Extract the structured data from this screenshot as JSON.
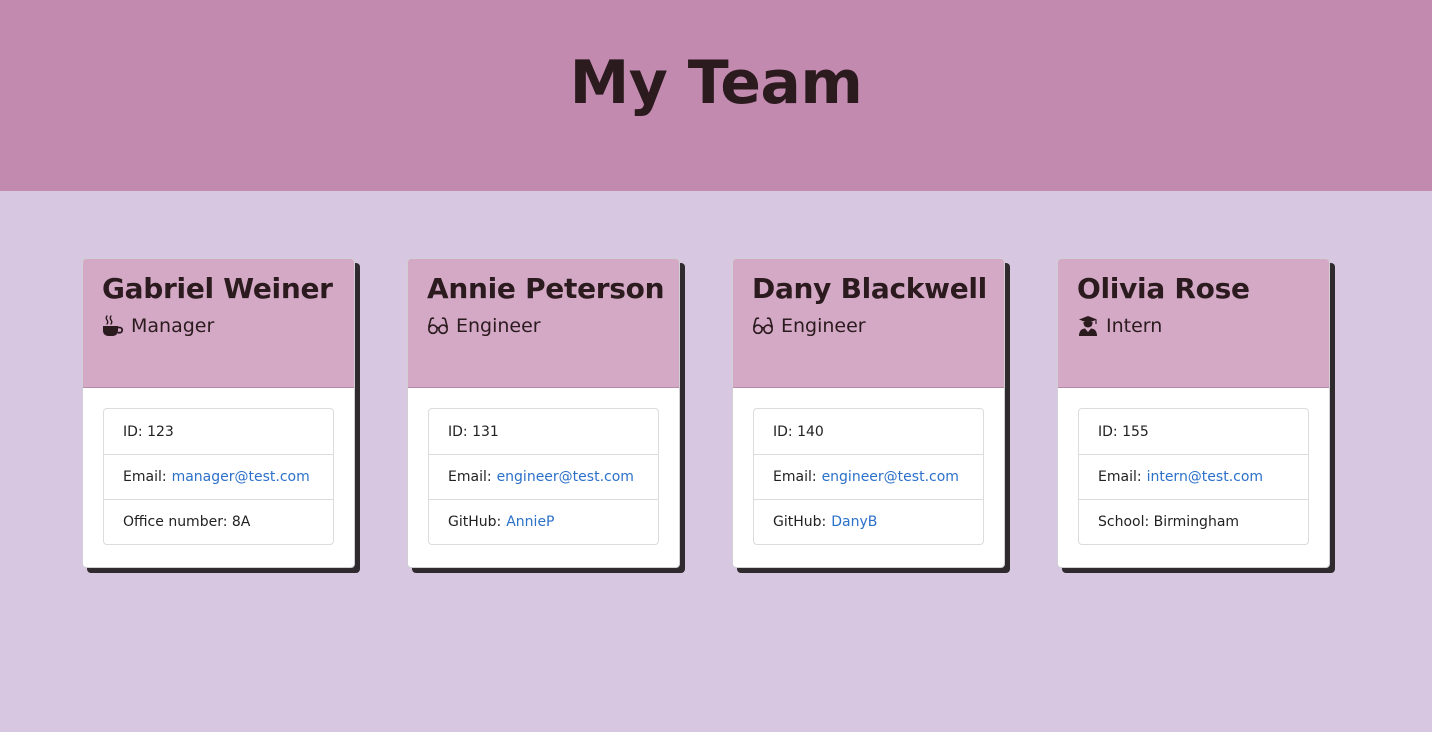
{
  "header": {
    "title": "My Team"
  },
  "cards": [
    {
      "name": "Gabriel Weiner",
      "role": "Manager",
      "role_icon": "coffee-mug-icon",
      "id_label": "ID:",
      "id_value": "123",
      "email_label": "Email:",
      "email": "manager@test.com",
      "extra_label": "Office number:",
      "extra_value": "8A"
    },
    {
      "name": "Annie Peterson",
      "role": "Engineer",
      "role_icon": "glasses-icon",
      "id_label": "ID:",
      "id_value": "131",
      "email_label": "Email:",
      "email": "engineer@test.com",
      "extra_label": "GitHub:",
      "extra_value": "AnnieP"
    },
    {
      "name": "Dany Blackwell",
      "role": "Engineer",
      "role_icon": "glasses-icon",
      "id_label": "ID:",
      "id_value": "140",
      "email_label": "Email:",
      "email": "engineer@test.com",
      "extra_label": "GitHub:",
      "extra_value": "DanyB"
    },
    {
      "name": "Olivia Rose",
      "role": "Intern",
      "role_icon": "graduate-icon",
      "id_label": "ID:",
      "id_value": "155",
      "email_label": "Email:",
      "email": "intern@test.com",
      "extra_label": "School:",
      "extra_value": "Birmingham"
    }
  ],
  "colors": {
    "header_bg": "#c28aaf",
    "page_bg": "#d7c7e1",
    "card_head_bg": "#d3a9c5",
    "link": "#2b70c9",
    "text": "#2b1a1e"
  }
}
